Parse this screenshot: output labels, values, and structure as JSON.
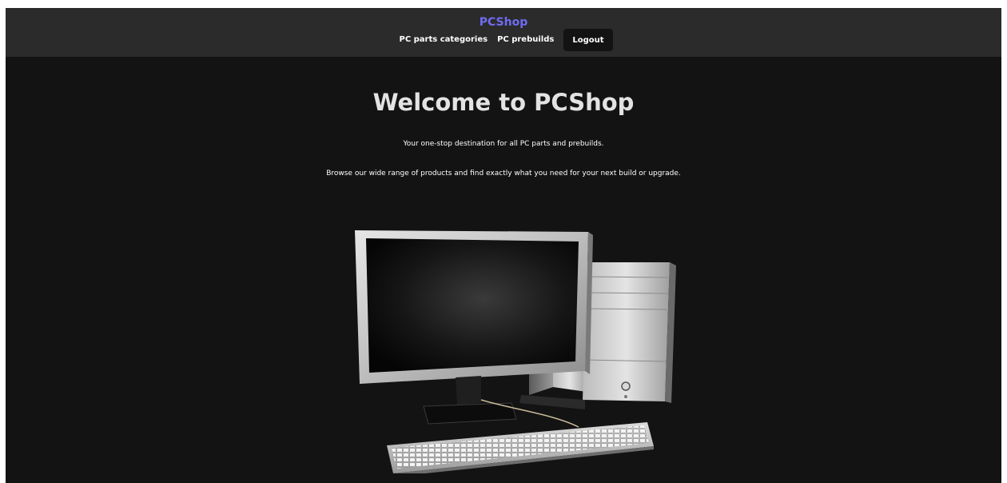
{
  "header": {
    "brand": "PCShop",
    "nav": {
      "parts": "PC parts categories",
      "prebuilds": "PC prebuilds",
      "logout": "Logout"
    }
  },
  "hero": {
    "title": "Welcome to PCShop",
    "line1": "Your one-stop destination for all PC parts and prebuilds.",
    "line2": "Browse our wide range of products and find exactly what you need for your next build or upgrade."
  },
  "colors": {
    "brand": "#6f6cf2",
    "page_background": "#131313",
    "navbar_background": "#2b2b2b",
    "title_text": "#e3e3e3"
  },
  "icons": {
    "hero_image": "desktop-computer-illustration"
  }
}
